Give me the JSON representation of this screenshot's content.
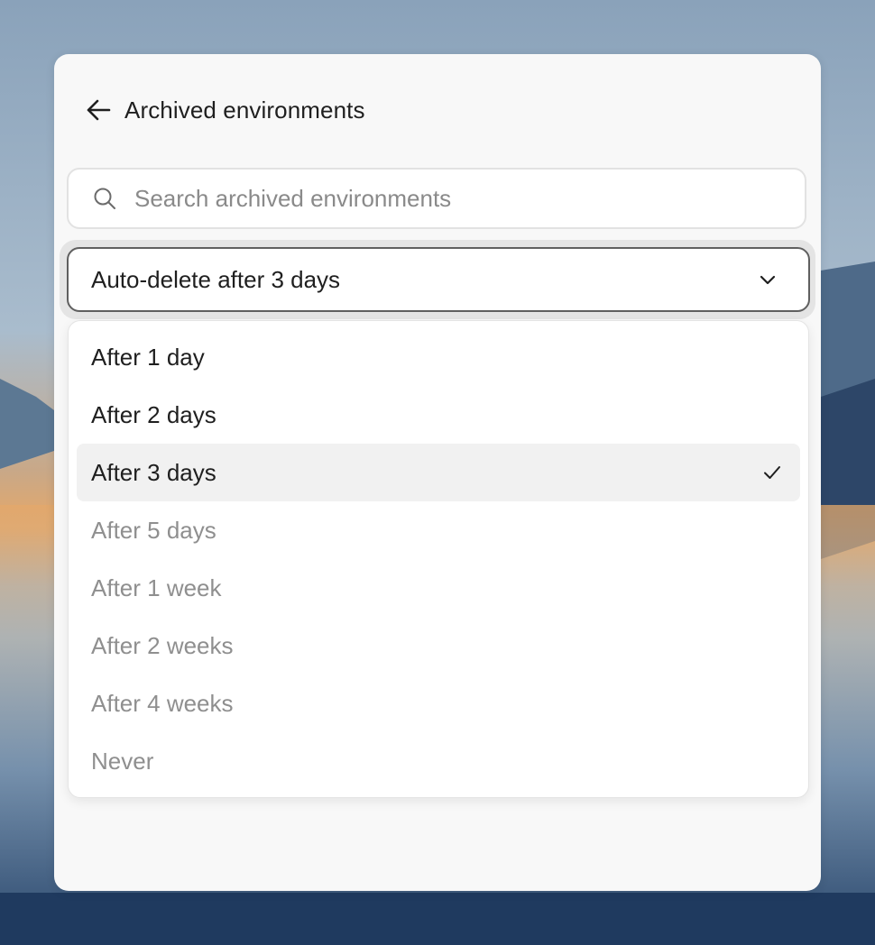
{
  "panel": {
    "back_icon": "arrow-left-icon",
    "title": "Archived environments"
  },
  "search": {
    "icon": "search-icon",
    "placeholder": "Search archived environments",
    "value": ""
  },
  "auto_delete": {
    "selected_label": "Auto-delete after 3 days",
    "expanded": true,
    "chevron_icon": "chevron-down-icon",
    "options": [
      {
        "label": "After 1 day",
        "state": "enabled",
        "selected": false
      },
      {
        "label": "After 2 days",
        "state": "enabled",
        "selected": false
      },
      {
        "label": "After 3 days",
        "state": "enabled",
        "selected": true
      },
      {
        "label": "After 5 days",
        "state": "disabled",
        "selected": false
      },
      {
        "label": "After 1 week",
        "state": "disabled",
        "selected": false
      },
      {
        "label": "After 2 weeks",
        "state": "disabled",
        "selected": false
      },
      {
        "label": "After 4 weeks",
        "state": "disabled",
        "selected": false
      },
      {
        "label": "Never",
        "state": "disabled",
        "selected": false
      }
    ],
    "check_icon": "checkmark-icon"
  },
  "colors": {
    "panel_background": "#f8f8f8",
    "text_primary": "#1f1f1f",
    "text_muted": "#8f8f8f",
    "selected_row": "#f1f1f1",
    "select_border": "#5f5f5f"
  }
}
